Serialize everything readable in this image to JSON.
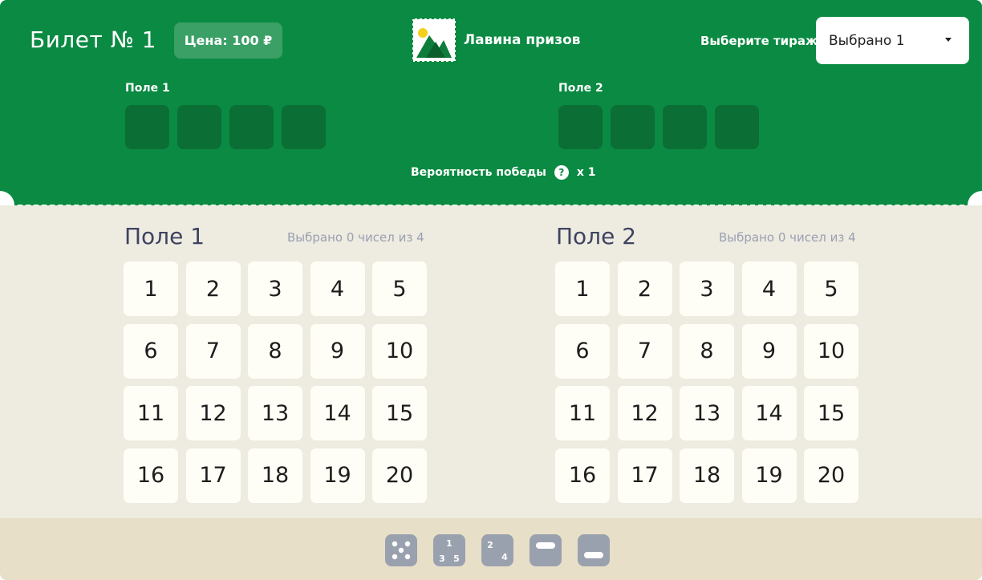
{
  "header": {
    "title": "Билет № 1",
    "price": "Цена: 100 ₽",
    "game_name": "Лавина призов",
    "logo_icon": "mountain-stamp-icon",
    "draw_label": "Выберите тираж",
    "draw_selected": "Выбрано 1",
    "probability_label": "Вероятность победы",
    "probability_help": "?",
    "probability_value": "x 1"
  },
  "fields_top": [
    {
      "label": "Поле 1",
      "slots": 4
    },
    {
      "label": "Поле 2",
      "slots": 4
    }
  ],
  "grids": [
    {
      "title": "Поле 1",
      "status": "Выбрано 0 чисел из 4",
      "numbers": [
        "1",
        "2",
        "3",
        "4",
        "5",
        "6",
        "7",
        "8",
        "9",
        "10",
        "11",
        "12",
        "13",
        "14",
        "15",
        "16",
        "17",
        "18",
        "19",
        "20"
      ]
    },
    {
      "title": "Поле 2",
      "status": "Выбрано 0 чисел из 4",
      "numbers": [
        "1",
        "2",
        "3",
        "4",
        "5",
        "6",
        "7",
        "8",
        "9",
        "10",
        "11",
        "12",
        "13",
        "14",
        "15",
        "16",
        "17",
        "18",
        "19",
        "20"
      ]
    }
  ],
  "toolbar": {
    "items": [
      {
        "icon": "dice-random-icon"
      },
      {
        "icon": "odd-numbers-icon",
        "digits": [
          "1",
          "3",
          "5"
        ]
      },
      {
        "icon": "even-numbers-icon",
        "digits": [
          "2",
          "4"
        ]
      },
      {
        "icon": "top-half-icon"
      },
      {
        "icon": "bottom-half-icon"
      }
    ]
  },
  "colors": {
    "header_green": "#0a8a42",
    "slot_green": "#0b6e35",
    "body_bg": "#eeebe1",
    "footer_bg": "#e8dfc8",
    "cell_bg": "#fffef6",
    "tool_gray": "#9aa1ae"
  }
}
